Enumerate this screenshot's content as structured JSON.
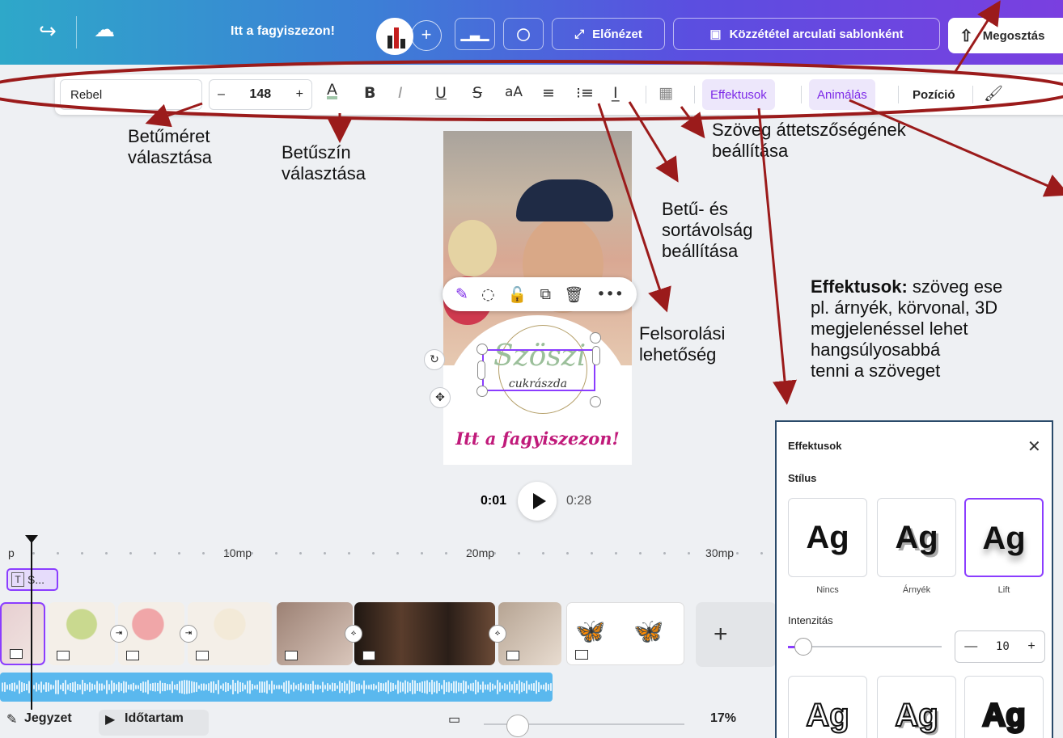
{
  "topbar": {
    "doc_title": "Itt a fagyiszezon!",
    "preview_label": "Előnézet",
    "publish_label": "Közzététel arculati sablonként",
    "share_label": "Megosztás"
  },
  "text_toolbar": {
    "font": "Rebel",
    "size_minus": "–",
    "size": "148",
    "size_plus": "+",
    "effects_label": "Effektusok",
    "animate_label": "Animálás",
    "position_label": "Pozíció"
  },
  "design": {
    "logo_main": "Szöszi",
    "logo_sub": "cukrászda",
    "headline": "Itt a fagyiszezon!"
  },
  "playback": {
    "current": "0:01",
    "total": "0:28"
  },
  "timeline": {
    "ruler": [
      "p",
      "10mp",
      "20mp",
      "30mp"
    ],
    "text_track_label": "S..."
  },
  "bottom_bar": {
    "notes_label": "Jegyzet",
    "duration_label": "Időtartam",
    "zoom": "17%"
  },
  "effects_panel": {
    "title": "Effektusok",
    "style_heading": "Stílus",
    "tiles": [
      {
        "sample": "Ag",
        "label": "Nincs"
      },
      {
        "sample": "Ag",
        "label": "Árnyék"
      },
      {
        "sample": "Ag",
        "label": "Lift"
      }
    ],
    "lower_tiles": [
      "Ag",
      "Ag",
      "Ag"
    ],
    "intensity_label": "Intenzitás",
    "intensity_value": "10",
    "intensity_max": 100,
    "intensity": 10
  },
  "annotations": {
    "font_size": [
      "Betűméret",
      "választása"
    ],
    "font_color": [
      "Betűszín",
      "választása"
    ],
    "transparency": [
      "Szöveg áttetszőségének",
      "beállítása"
    ],
    "spacing": [
      "Betű- és",
      "sortávolság",
      "beállítása"
    ],
    "list": [
      "Felsorolási",
      "lehetőség"
    ],
    "effects_title": "Effektusok:",
    "effects_desc": [
      " szöveg ese",
      "pl. árnyék, körvonal, 3D",
      "megjelenéssel lehet",
      "hangsúlyosabbá",
      "tenni a szöveget"
    ]
  },
  "colors": {
    "annotation_red": "#9b1b1b",
    "accent_purple": "#8b3dff",
    "headline_magenta": "#c01a7a"
  }
}
